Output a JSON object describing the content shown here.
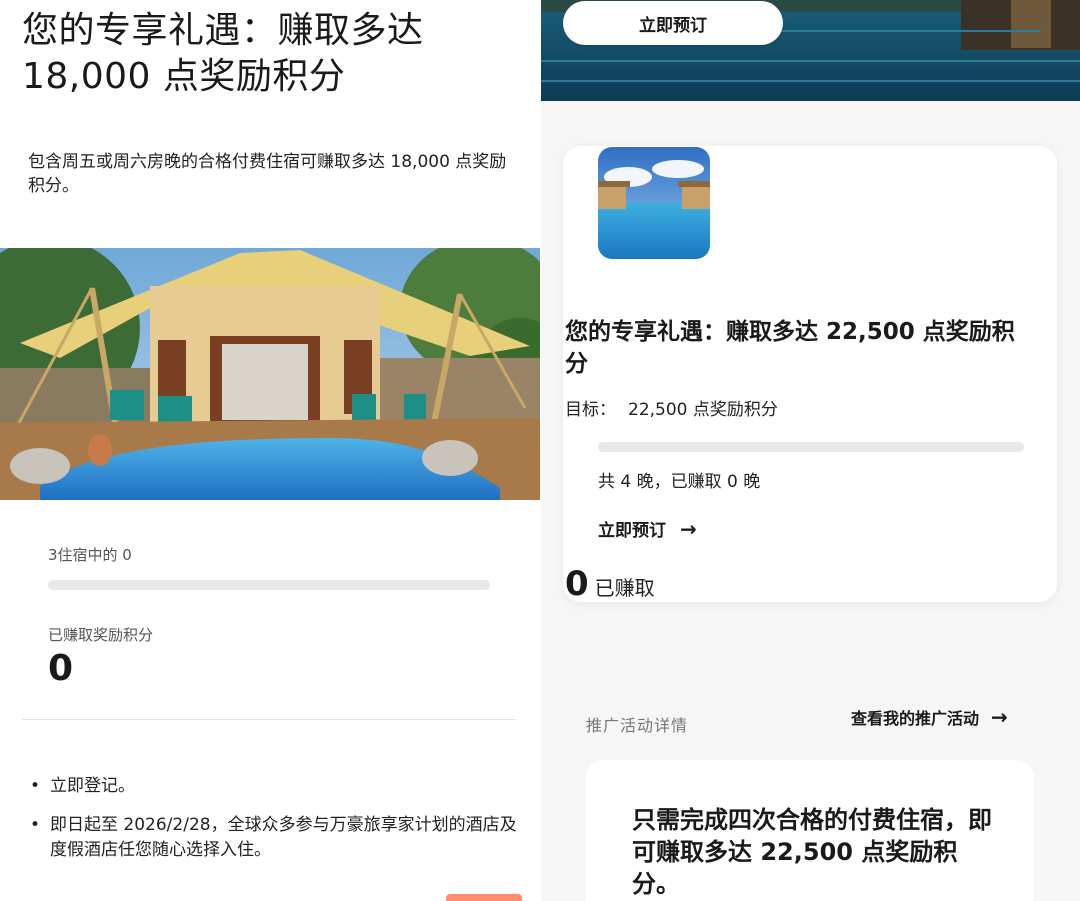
{
  "left": {
    "hero_title": "您的专享礼遇：赚取多达 18,000 点奖励积分",
    "description": "包含周五或周六房晚的合格付费住宿可赚取多达 18,000 点奖励积分。",
    "stays_progress_label": "3住宿中的 0",
    "stays_progress": 0,
    "earned_points_label": "已赚取奖励积分",
    "earned_points_value": "0",
    "bullets": [
      "立即登记。",
      "即日起至 2026/2/28，全球众多参与万豪旅享家计划的酒店及度假酒店任您随心选择入住。"
    ]
  },
  "right": {
    "book_now_pill": "立即预订",
    "card": {
      "title": "您的专享礼遇：赚取多达 22,500 点奖励积分",
      "target_label": "目标：",
      "target_value": "22,500 点奖励积分",
      "progress": 0,
      "nights_text": "共 4 晚，已赚取 0 晚",
      "book_link": "立即预订",
      "earned_number": "0",
      "earned_label": "已赚取"
    },
    "promo_details_label": "推广活动详情",
    "my_promos_link": "查看我的推广活动",
    "promo_card_text": "只需完成四次合格的付费住宿，即可赚取多达 22,500 点奖励积分。"
  },
  "icons": {
    "arrow": "arrow-right-icon"
  },
  "colors": {
    "accent": "#ff8d6b",
    "track": "#e8e8e8"
  }
}
